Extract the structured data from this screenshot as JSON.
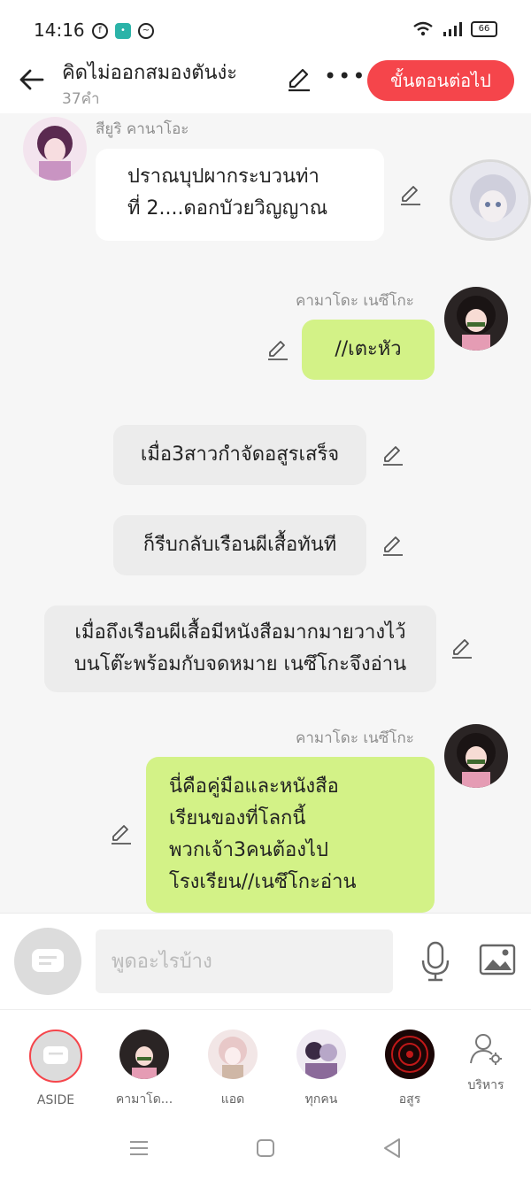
{
  "status": {
    "time": "14:16",
    "battery": "66"
  },
  "header": {
    "title": "คิดไม่ออกสมองตันง่ะ",
    "subtitle": "37คำ",
    "next_button": "ขั้นตอนต่อไป"
  },
  "messages": [
    {
      "name": "สียูริ คานาโอะ",
      "text": [
        "ปราณบุปผากระบวนท่า",
        "ที่ 2....ดอกบัวยวิญญาณ"
      ]
    },
    {
      "name": "คามาโดะ เนซึโกะ",
      "text": [
        "//เตะหัว"
      ]
    },
    {
      "text": [
        "เมื่อ3สาวกำจัดอสูรเสร็จ"
      ]
    },
    {
      "text": [
        "ก็รีบกลับเรือนผีเสื้อทันที"
      ]
    },
    {
      "text": [
        "เมื่อถึงเรือนผีเสื้อมีหนังสือมากมายวางไว้",
        "บนโต๊ะพร้อมกับจดหมาย เนซึโกะจึงอ่าน"
      ]
    },
    {
      "name": "คามาโดะ เนซึโกะ",
      "text": [
        "นี่คือคู่มือและหนังสือ",
        "เรียนของที่โลกนี้",
        "พวกเจ้า3คนต้องไป",
        "โรงเรียน//เนซึโกะอ่าน"
      ]
    }
  ],
  "composer": {
    "placeholder": "พูดอะไรบ้าง"
  },
  "roles": [
    {
      "label": "ASIDE"
    },
    {
      "label": "คามาโด..."
    },
    {
      "label": "แอด"
    },
    {
      "label": "ทุกคน"
    },
    {
      "label": "อสูร"
    },
    {
      "label": "บริหาร"
    }
  ],
  "colors": {
    "accent": "#f5454b",
    "green_bubble": "#d3f287",
    "gray_bubble": "#ececec",
    "chat_bg": "#f6f6f6"
  }
}
